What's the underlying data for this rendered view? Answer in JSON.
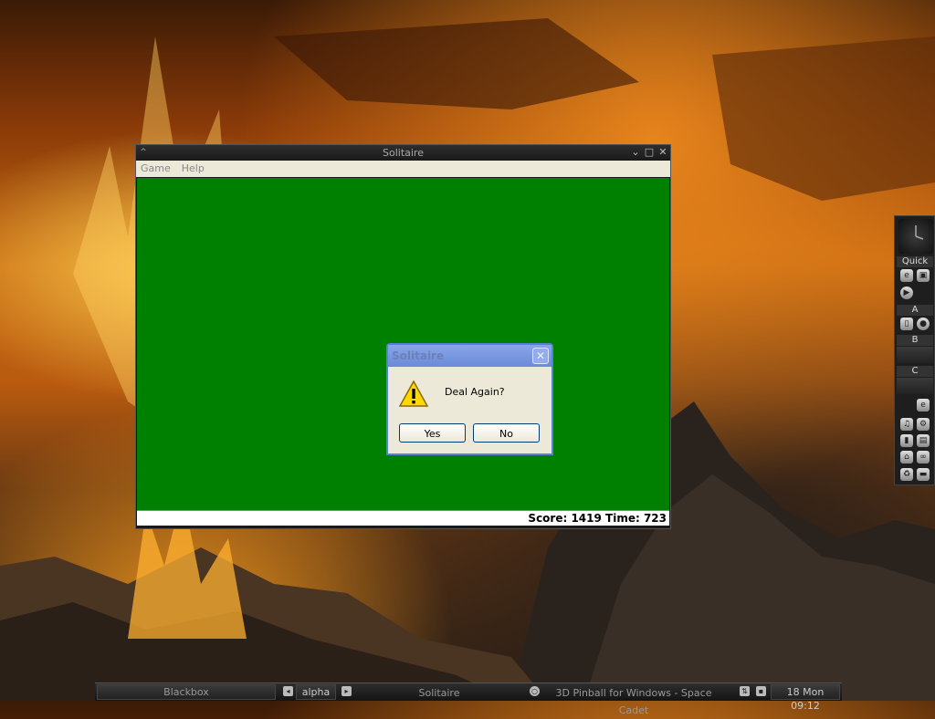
{
  "solitaire_window": {
    "title": "Solitaire",
    "menu": [
      "Game",
      "Help"
    ],
    "status": "Score: 1419 Time: 723"
  },
  "dialog": {
    "title": "Solitaire",
    "message": "Deal Again?",
    "yes_label": "Yes",
    "no_label": "No",
    "close_glyph": "✕"
  },
  "slit": {
    "labels": [
      "Quick",
      "A",
      "B",
      "C"
    ]
  },
  "taskbar": {
    "workspace_name": "Blackbox",
    "desktop_name": "alpha",
    "tasks": [
      "Solitaire",
      "3D Pinball for Windows - Space Cadet"
    ],
    "clock": "18 Mon 09:12"
  },
  "colors": {
    "felt": "#008000",
    "dialog_title": "#7a98e0"
  }
}
